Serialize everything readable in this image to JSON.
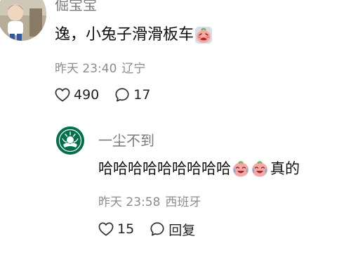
{
  "comments": [
    {
      "author": "倔宝宝",
      "content": "逸，小兔子滑滑板车",
      "content_emoji": "embarrassed-face-emoji",
      "time": "昨天 23:40",
      "location": "辽宁",
      "likes": "490",
      "replies": "17"
    }
  ],
  "reply": {
    "author": "一尘不到",
    "content": "哈哈哈哈哈哈哈哈哈",
    "content_emojis": [
      "laugh-cry-emoji",
      "laugh-cry-emoji"
    ],
    "content_after": "真的",
    "time": "昨天 23:58",
    "location": "西班牙",
    "likes": "15",
    "reply_label": "回复"
  },
  "icons": {
    "like": "heart-outline-icon",
    "comment": "speech-bubble-icon"
  },
  "colors": {
    "text": "#111111",
    "secondary": "#8c8c8c",
    "author": "#7a7a7a",
    "avatar_brand": "#00704a"
  }
}
